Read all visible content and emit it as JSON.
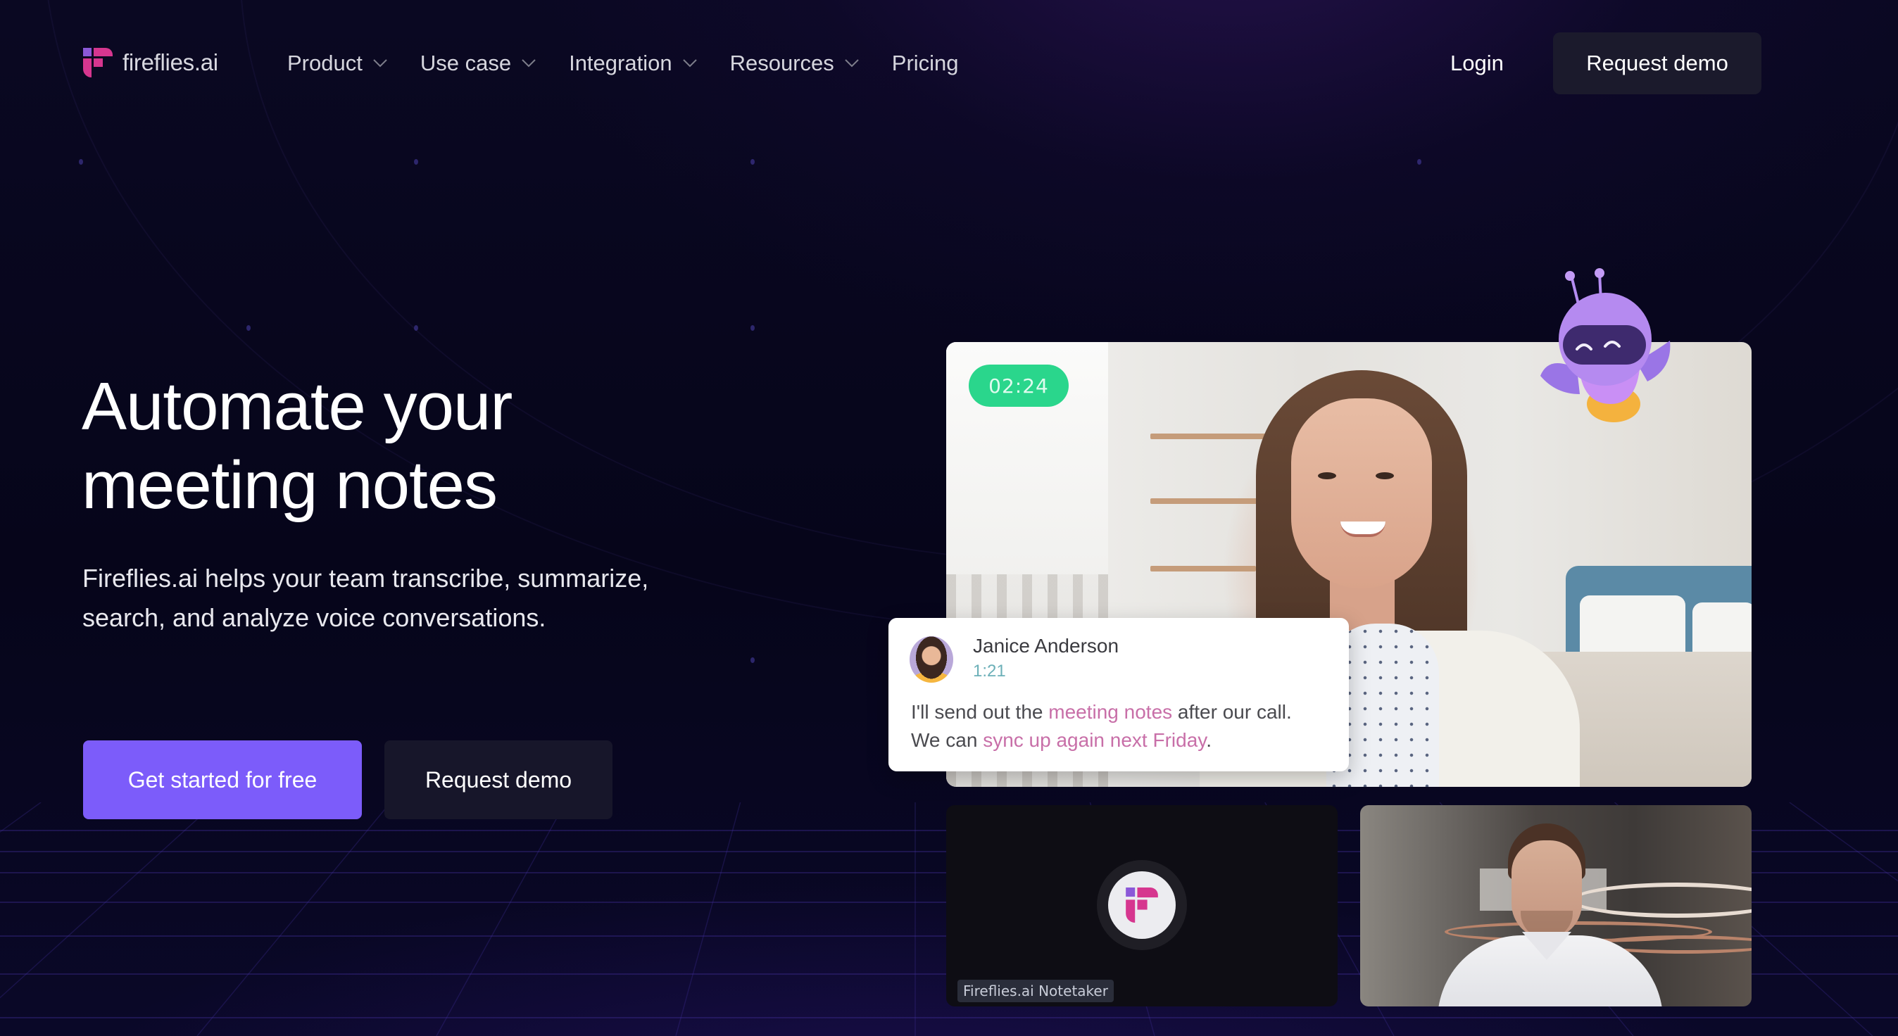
{
  "nav": {
    "brand": "fireflies.ai",
    "menu": [
      {
        "label": "Product",
        "has_dropdown": true
      },
      {
        "label": "Use case",
        "has_dropdown": true
      },
      {
        "label": "Integration",
        "has_dropdown": true
      },
      {
        "label": "Resources",
        "has_dropdown": true
      },
      {
        "label": "Pricing",
        "has_dropdown": false
      }
    ],
    "login_label": "Login",
    "request_demo_label": "Request demo"
  },
  "hero": {
    "title_lines": [
      "Automate your",
      "meeting notes"
    ],
    "subtitle_lines": [
      "Fireflies.ai helps your team transcribe, summarize,",
      "search, and analyze voice conversations."
    ],
    "primary_cta": "Get started for free",
    "secondary_cta": "Request demo"
  },
  "demo": {
    "timer": "02:24",
    "caption": {
      "speaker": "Janice Anderson",
      "timestamp": "1:21",
      "segments": [
        {
          "text": "I'll send out the ",
          "highlight": false
        },
        {
          "text": "meeting notes",
          "highlight": true
        },
        {
          "text": " after our call.",
          "highlight": false
        },
        {
          "text": "We can ",
          "highlight": false,
          "newline": true
        },
        {
          "text": "sync up again next Friday",
          "highlight": true
        },
        {
          "text": ".",
          "highlight": false
        }
      ]
    },
    "notetaker_label": "Fireflies.ai Notetaker"
  },
  "colors": {
    "primary": "#7c5cfa",
    "brand_pink": "#d6368f",
    "timer_green": "#2ad68c",
    "caption_highlight": "#c86fa8",
    "background": "#05041a"
  }
}
